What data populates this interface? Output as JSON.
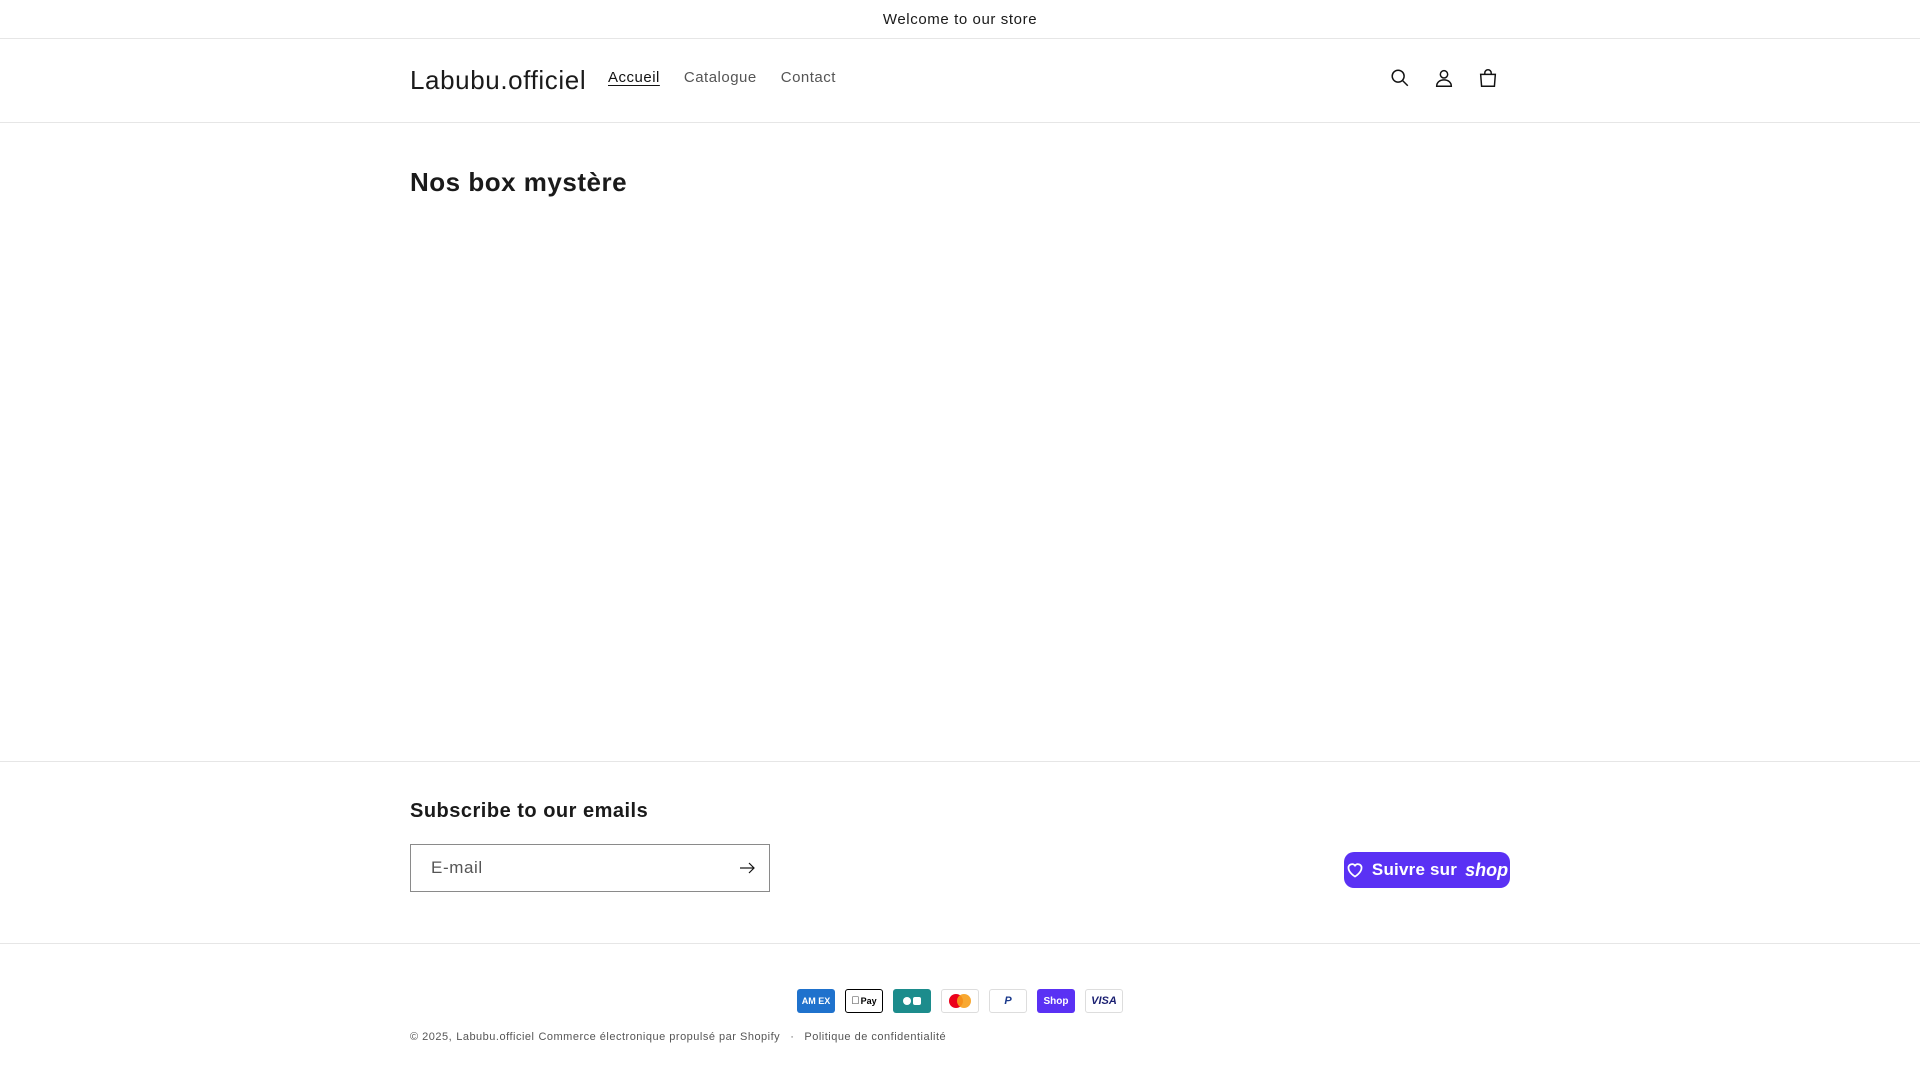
{
  "announcement": {
    "text": "Welcome to our store"
  },
  "header": {
    "logo": "Labubu.officiel",
    "nav": [
      {
        "label": "Accueil",
        "active": true
      },
      {
        "label": "Catalogue",
        "active": false
      },
      {
        "label": "Contact",
        "active": false
      }
    ],
    "icons": [
      "search-icon",
      "account-icon",
      "cart-icon"
    ]
  },
  "main": {
    "title": "Nos box mystère"
  },
  "newsletter": {
    "heading": "Subscribe to our emails",
    "email_placeholder": "E-mail",
    "submit_icon": "arrow-right-icon"
  },
  "shop_follow": {
    "label": "Suivre sur",
    "brand": "shop",
    "color": "#5a31f4"
  },
  "payments": [
    {
      "name": "american-express",
      "label": "AM EX"
    },
    {
      "name": "apple-pay",
      "label": "Pay"
    },
    {
      "name": "cartes-bancaires",
      "label": ""
    },
    {
      "name": "mastercard",
      "label": ""
    },
    {
      "name": "paypal",
      "label": "P"
    },
    {
      "name": "shop-pay",
      "label": "Shop"
    },
    {
      "name": "visa",
      "label": "VISA"
    }
  ],
  "footer": {
    "copyright": "© 2025,",
    "store_link": "Labubu.officiel",
    "powered_by": "Commerce électronique propulsé par Shopify",
    "separator": "·",
    "privacy": "Politique de confidentialité"
  }
}
